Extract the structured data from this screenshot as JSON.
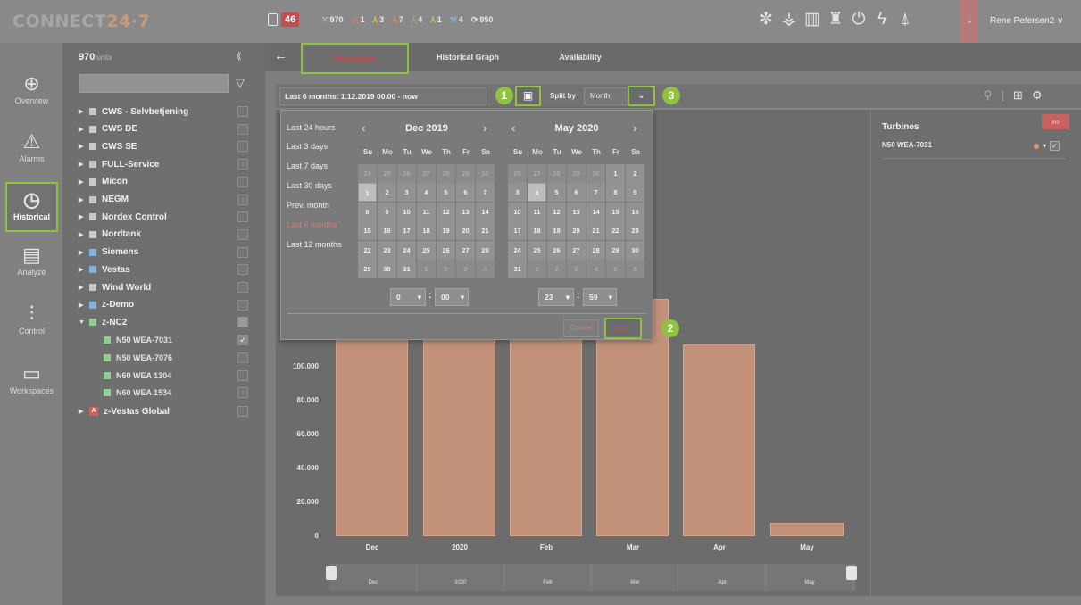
{
  "app": {
    "logo_main": "CONNECT",
    "logo_accent": "24·7",
    "user": "Rene Petersen2 ∨"
  },
  "topbar": {
    "alarm_count": "46",
    "stats": [
      {
        "icon": "grid-icon",
        "glyph": "⁙",
        "value": "970"
      },
      {
        "icon": "warning-icon",
        "glyph": "⚠",
        "value": "1"
      },
      {
        "icon": "turbine-yellow-icon",
        "glyph": "⅄",
        "value": "3"
      },
      {
        "icon": "turbine-orange-icon",
        "glyph": "⅄",
        "value": "7"
      },
      {
        "icon": "turbine-green-icon",
        "glyph": "⅄",
        "value": "4"
      },
      {
        "icon": "turbine-lime-icon",
        "glyph": "⅄",
        "value": "1"
      },
      {
        "icon": "wrench-icon",
        "glyph": "⚒",
        "value": "4"
      },
      {
        "icon": "refresh-icon",
        "glyph": "⟳",
        "value": "950"
      }
    ],
    "type_icons": [
      "wind-turbine-icon",
      "solar-park-icon",
      "factory-icon",
      "tower-icon",
      "plug-icon",
      "bolt-icon",
      "pylon-icon"
    ]
  },
  "nav": [
    {
      "label": "Overview",
      "icon": "globe-icon",
      "glyph": "⊕"
    },
    {
      "label": "Alarms",
      "icon": "alarm-icon",
      "glyph": "⚠"
    },
    {
      "label": "Historical",
      "icon": "history-icon",
      "glyph": "◷"
    },
    {
      "label": "Analyze",
      "icon": "analyze-icon",
      "glyph": "▤"
    },
    {
      "label": "Control",
      "icon": "sliders-icon",
      "glyph": "⫶"
    },
    {
      "label": "Workspaces",
      "icon": "monitor-icon",
      "glyph": "▭"
    }
  ],
  "tree": {
    "units_count": "970",
    "units_label": "units",
    "collapse": "⟪",
    "items": [
      {
        "label": "CWS - Selvbetjening",
        "color": "#c8c8c8",
        "level": 0,
        "checked": false,
        "expanded": false
      },
      {
        "label": "CWS DE",
        "color": "#c8c8c8",
        "level": 0,
        "checked": false,
        "expanded": false
      },
      {
        "label": "CWS SE",
        "color": "#c8c8c8",
        "level": 0,
        "checked": false,
        "expanded": false
      },
      {
        "label": "FULL-Service",
        "color": "#c8c8c8",
        "level": 0,
        "checked": false,
        "expanded": false
      },
      {
        "label": "Micon",
        "color": "#c8c8c8",
        "level": 0,
        "checked": false,
        "expanded": false
      },
      {
        "label": "NEGM",
        "color": "#c8c8c8",
        "level": 0,
        "checked": false,
        "expanded": false
      },
      {
        "label": "Nordex Control",
        "color": "#c8c8c8",
        "level": 0,
        "checked": false,
        "expanded": false
      },
      {
        "label": "Nordtank",
        "color": "#c8c8c8",
        "level": 0,
        "checked": false,
        "expanded": false
      },
      {
        "label": "Siemens",
        "color": "#7fb0e0",
        "level": 0,
        "checked": false,
        "expanded": false
      },
      {
        "label": "Vestas",
        "color": "#7fb0e0",
        "level": 0,
        "checked": false,
        "expanded": false
      },
      {
        "label": "Wind World",
        "color": "#c8c8c8",
        "level": 0,
        "checked": false,
        "expanded": false
      },
      {
        "label": "z-Demo",
        "color": "#7fb0e0",
        "level": 0,
        "checked": false,
        "expanded": false
      },
      {
        "label": "z-NC2",
        "color": "#8fcf8f",
        "level": 0,
        "checked": false,
        "expanded": true
      },
      {
        "label": "N50 WEA-7031",
        "color": "#8fcf8f",
        "level": 1,
        "checked": true
      },
      {
        "label": "N50 WEA-7076",
        "color": "#8fcf8f",
        "level": 1,
        "checked": false
      },
      {
        "label": "N60 WEA 1304",
        "color": "#8fcf8f",
        "level": 1,
        "checked": false
      },
      {
        "label": "N60 WEA 1534",
        "color": "#8fcf8f",
        "level": 1,
        "checked": false
      },
      {
        "label": "z-Vestas Global",
        "color": "#d06060",
        "level": 0,
        "checked": false,
        "expanded": false,
        "badge": "A"
      }
    ]
  },
  "tabs": [
    {
      "label": "Production",
      "active": true
    },
    {
      "label": "Historical Graph",
      "active": false
    },
    {
      "label": "Availability",
      "active": false
    }
  ],
  "toolbar": {
    "range": "Last 6 months: 1.12.2019 00.00 - now",
    "split_label": "Split by",
    "split_value": "Month"
  },
  "markers": [
    "1",
    "2",
    "3"
  ],
  "datepicker": {
    "presets": [
      "Last 24 hours",
      "Last 3 days",
      "Last 7 days",
      "Last 30 days",
      "Prev. month",
      "Last 6 months",
      "Last 12 months"
    ],
    "selected_preset": "Last 6 months",
    "left": {
      "title": "Dec 2019",
      "dows": [
        "Su",
        "Mo",
        "Tu",
        "We",
        "Th",
        "Fr",
        "Sa"
      ],
      "weeks": [
        [
          "24",
          "25",
          "26",
          "27",
          "28",
          "29",
          "30"
        ],
        [
          "1",
          "2",
          "3",
          "4",
          "5",
          "6",
          "7"
        ],
        [
          "8",
          "9",
          "10",
          "11",
          "12",
          "13",
          "14"
        ],
        [
          "15",
          "16",
          "17",
          "18",
          "19",
          "20",
          "21"
        ],
        [
          "22",
          "23",
          "24",
          "25",
          "26",
          "27",
          "28"
        ],
        [
          "29",
          "30",
          "31",
          "1",
          "2",
          "3",
          "4"
        ]
      ],
      "selected_day": "1",
      "time_hour": "0",
      "time_min": "00"
    },
    "right": {
      "title": "May 2020",
      "dows": [
        "Su",
        "Mo",
        "Tu",
        "We",
        "Th",
        "Fr",
        "Sa"
      ],
      "weeks": [
        [
          "26",
          "27",
          "28",
          "29",
          "30",
          "1",
          "2"
        ],
        [
          "3",
          "4",
          "5",
          "6",
          "7",
          "8",
          "9"
        ],
        [
          "10",
          "11",
          "12",
          "13",
          "14",
          "15",
          "16"
        ],
        [
          "17",
          "18",
          "19",
          "20",
          "21",
          "22",
          "23"
        ],
        [
          "24",
          "25",
          "26",
          "27",
          "28",
          "29",
          "30"
        ],
        [
          "31",
          "1",
          "2",
          "3",
          "4",
          "5",
          "6"
        ]
      ],
      "selected_day": "4",
      "time_hour": "23",
      "time_min": "59"
    },
    "cancel": "Cancel",
    "ok": "OK"
  },
  "chart_data": {
    "type": "bar",
    "categories": [
      "Dec",
      "2020",
      "Feb",
      "Mar",
      "Apr",
      "May"
    ],
    "values": [
      118000,
      118000,
      118000,
      140000,
      113000,
      8000
    ],
    "yticks": [
      "0",
      "20.000",
      "40.000",
      "60.000",
      "80.000",
      "100.000"
    ],
    "ylim": [
      0,
      140000
    ],
    "navigator_labels": [
      "Dec",
      "2020",
      "Feb",
      "Mar",
      "Apr",
      "May"
    ],
    "bar_color": "#c39079"
  },
  "turbines": {
    "title": "Turbines",
    "expand": "›››",
    "items": [
      {
        "name": "N50 WEA-7031",
        "checked": true
      }
    ]
  }
}
